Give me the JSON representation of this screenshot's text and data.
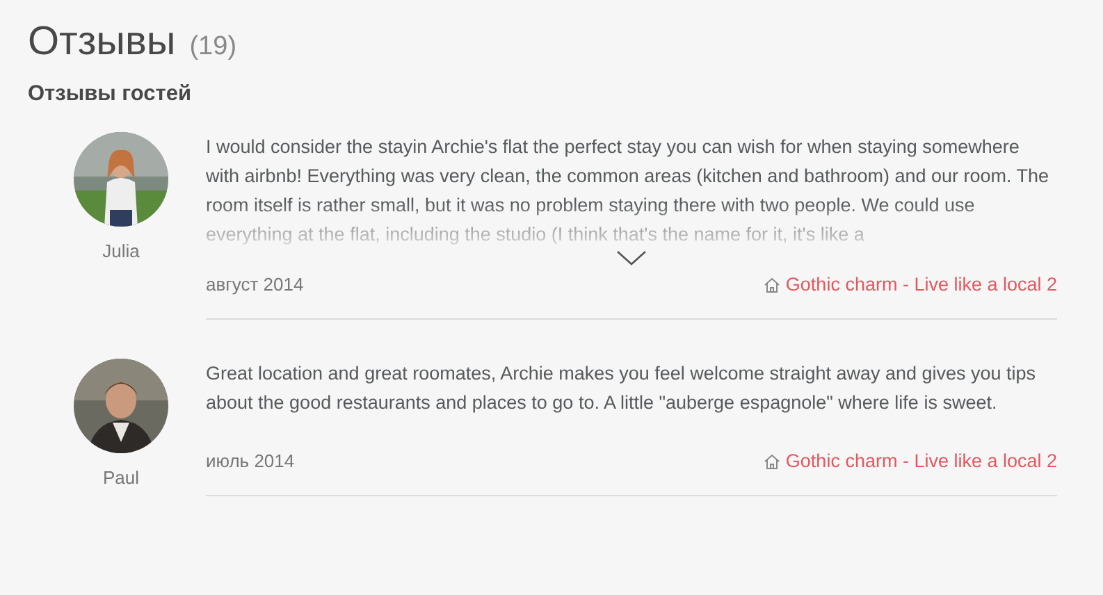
{
  "header": {
    "title": "Отзывы",
    "count": "(19)"
  },
  "section_title": "Отзывы гостей",
  "reviews": [
    {
      "name": "Julia",
      "text": "I would consider the stayin Archie's flat the perfect stay you can wish for when staying somewhere with airbnb! Everything was very clean, the common areas (kitchen and bathroom) and our room. The room itself is rather small, but it was no problem staying there with two people. We could use everything at the flat, including the studio (I think that's the name for it, it's like a",
      "expanded": false,
      "date": "август 2014",
      "listing": "Gothic charm - Live like a local 2"
    },
    {
      "name": "Paul",
      "text": "Great location and great roomates, Archie makes you feel welcome straight away and gives you tips about the good restaurants and places to go to. A little \"auberge espagnole\" where life is sweet.",
      "expanded": true,
      "date": "июль 2014",
      "listing": "Gothic charm - Live like a local 2"
    }
  ]
}
